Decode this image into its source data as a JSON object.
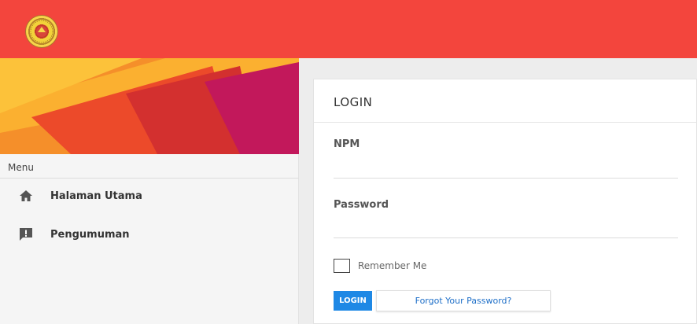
{
  "header": {
    "logo_icon": "university-seal-logo",
    "bg_color": "#f3453d"
  },
  "sidebar": {
    "menu_label": "Menu",
    "items": [
      {
        "label": "Halaman Utama",
        "icon": "home-icon"
      },
      {
        "label": "Pengumuman",
        "icon": "announcement-icon"
      }
    ]
  },
  "login": {
    "title": "LOGIN",
    "npm_label": "NPM",
    "npm_value": "",
    "password_label": "Password",
    "password_value": "",
    "remember_label": "Remember Me",
    "remember_checked": false,
    "login_button": "LOGIN",
    "forgot_button": "Forgot Your Password?",
    "accent_color": "#1e88e5"
  }
}
